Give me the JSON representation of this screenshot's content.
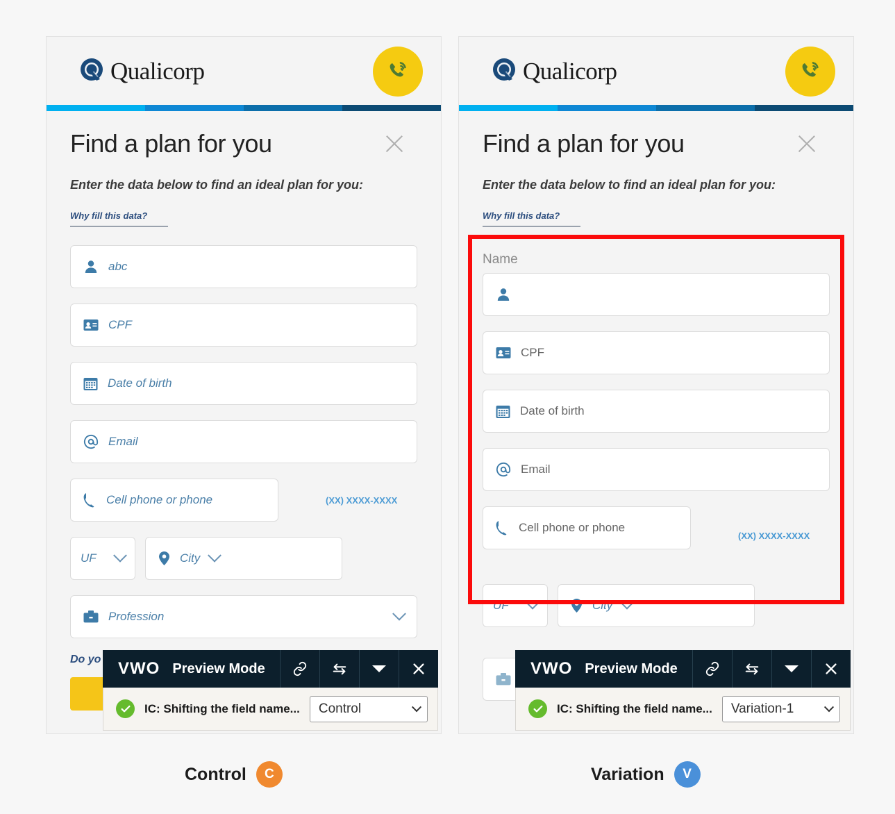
{
  "background_color": "#f7f7f7",
  "brand": {
    "name": "Qualicorp",
    "logo_icon": "qualicorp-q-logo",
    "phone_button_icon": "phone-ringing-icon",
    "phone_button_bg": "#f5cb11",
    "phone_icon_color": "#4e7a33"
  },
  "accent_bar": {
    "segments": [
      {
        "color": "#00b0f0",
        "width_pct": 25
      },
      {
        "color": "#0e87d4",
        "width_pct": 25
      },
      {
        "color": "#0c6eaa",
        "width_pct": 25
      },
      {
        "color": "#0c4a73",
        "width_pct": 25
      }
    ]
  },
  "modal": {
    "title": "Find a plan for you",
    "close_icon": "close-icon",
    "subtitle": "Enter the data below to find an ideal plan for you:",
    "why_link": "Why fill this data?"
  },
  "control": {
    "caption": "Control",
    "badge_letter": "C",
    "badge_color": "#f0892f",
    "fields": [
      {
        "icon": "person-icon",
        "label": "abc",
        "is_value": true
      },
      {
        "icon": "id-card-icon",
        "label": "CPF",
        "is_value": false
      },
      {
        "icon": "calendar-icon",
        "label": "Date of birth",
        "is_value": false
      },
      {
        "icon": "at-sign-icon",
        "label": "Email",
        "is_value": false
      },
      {
        "icon": "phone-icon",
        "label": "Cell phone or phone",
        "is_value": false
      }
    ],
    "phone_hint": "(XX) XXXX-XXXX",
    "uf_label": "UF",
    "city_label": "City",
    "city_icon": "map-pin-icon",
    "profession_label": "Profession",
    "profession_icon": "briefcase-icon",
    "bottom_note": "Do yo"
  },
  "variation": {
    "caption": "Variation",
    "badge_letter": "V",
    "badge_color": "#4a90d9",
    "highlight_color": "#fb0b0b",
    "group_label": "Name",
    "fields": [
      {
        "icon": "person-icon",
        "label": "",
        "is_value": false
      },
      {
        "icon": "id-card-icon",
        "label": "CPF",
        "is_value": false
      },
      {
        "icon": "calendar-icon",
        "label": "Date of birth",
        "is_value": false
      },
      {
        "icon": "at-sign-icon",
        "label": "Email",
        "is_value": false
      },
      {
        "icon": "phone-icon",
        "label": "Cell phone or phone",
        "is_value": false
      }
    ],
    "phone_hint": "(XX) XXXX-XXXX",
    "uf_label": "UF",
    "city_label": "City",
    "city_icon": "map-pin-icon",
    "profession_icon": "briefcase-icon"
  },
  "vwo": {
    "logo": "VWO",
    "mode_label": "Preview Mode",
    "tools": [
      "link-icon",
      "swap-arrows-icon",
      "chevron-down-icon",
      "close-icon"
    ],
    "status_icon": "check-circle-icon",
    "experiment_name": "IC: Shifting the field name...",
    "control_selection": "Control",
    "variation_selection": "Variation-1"
  }
}
